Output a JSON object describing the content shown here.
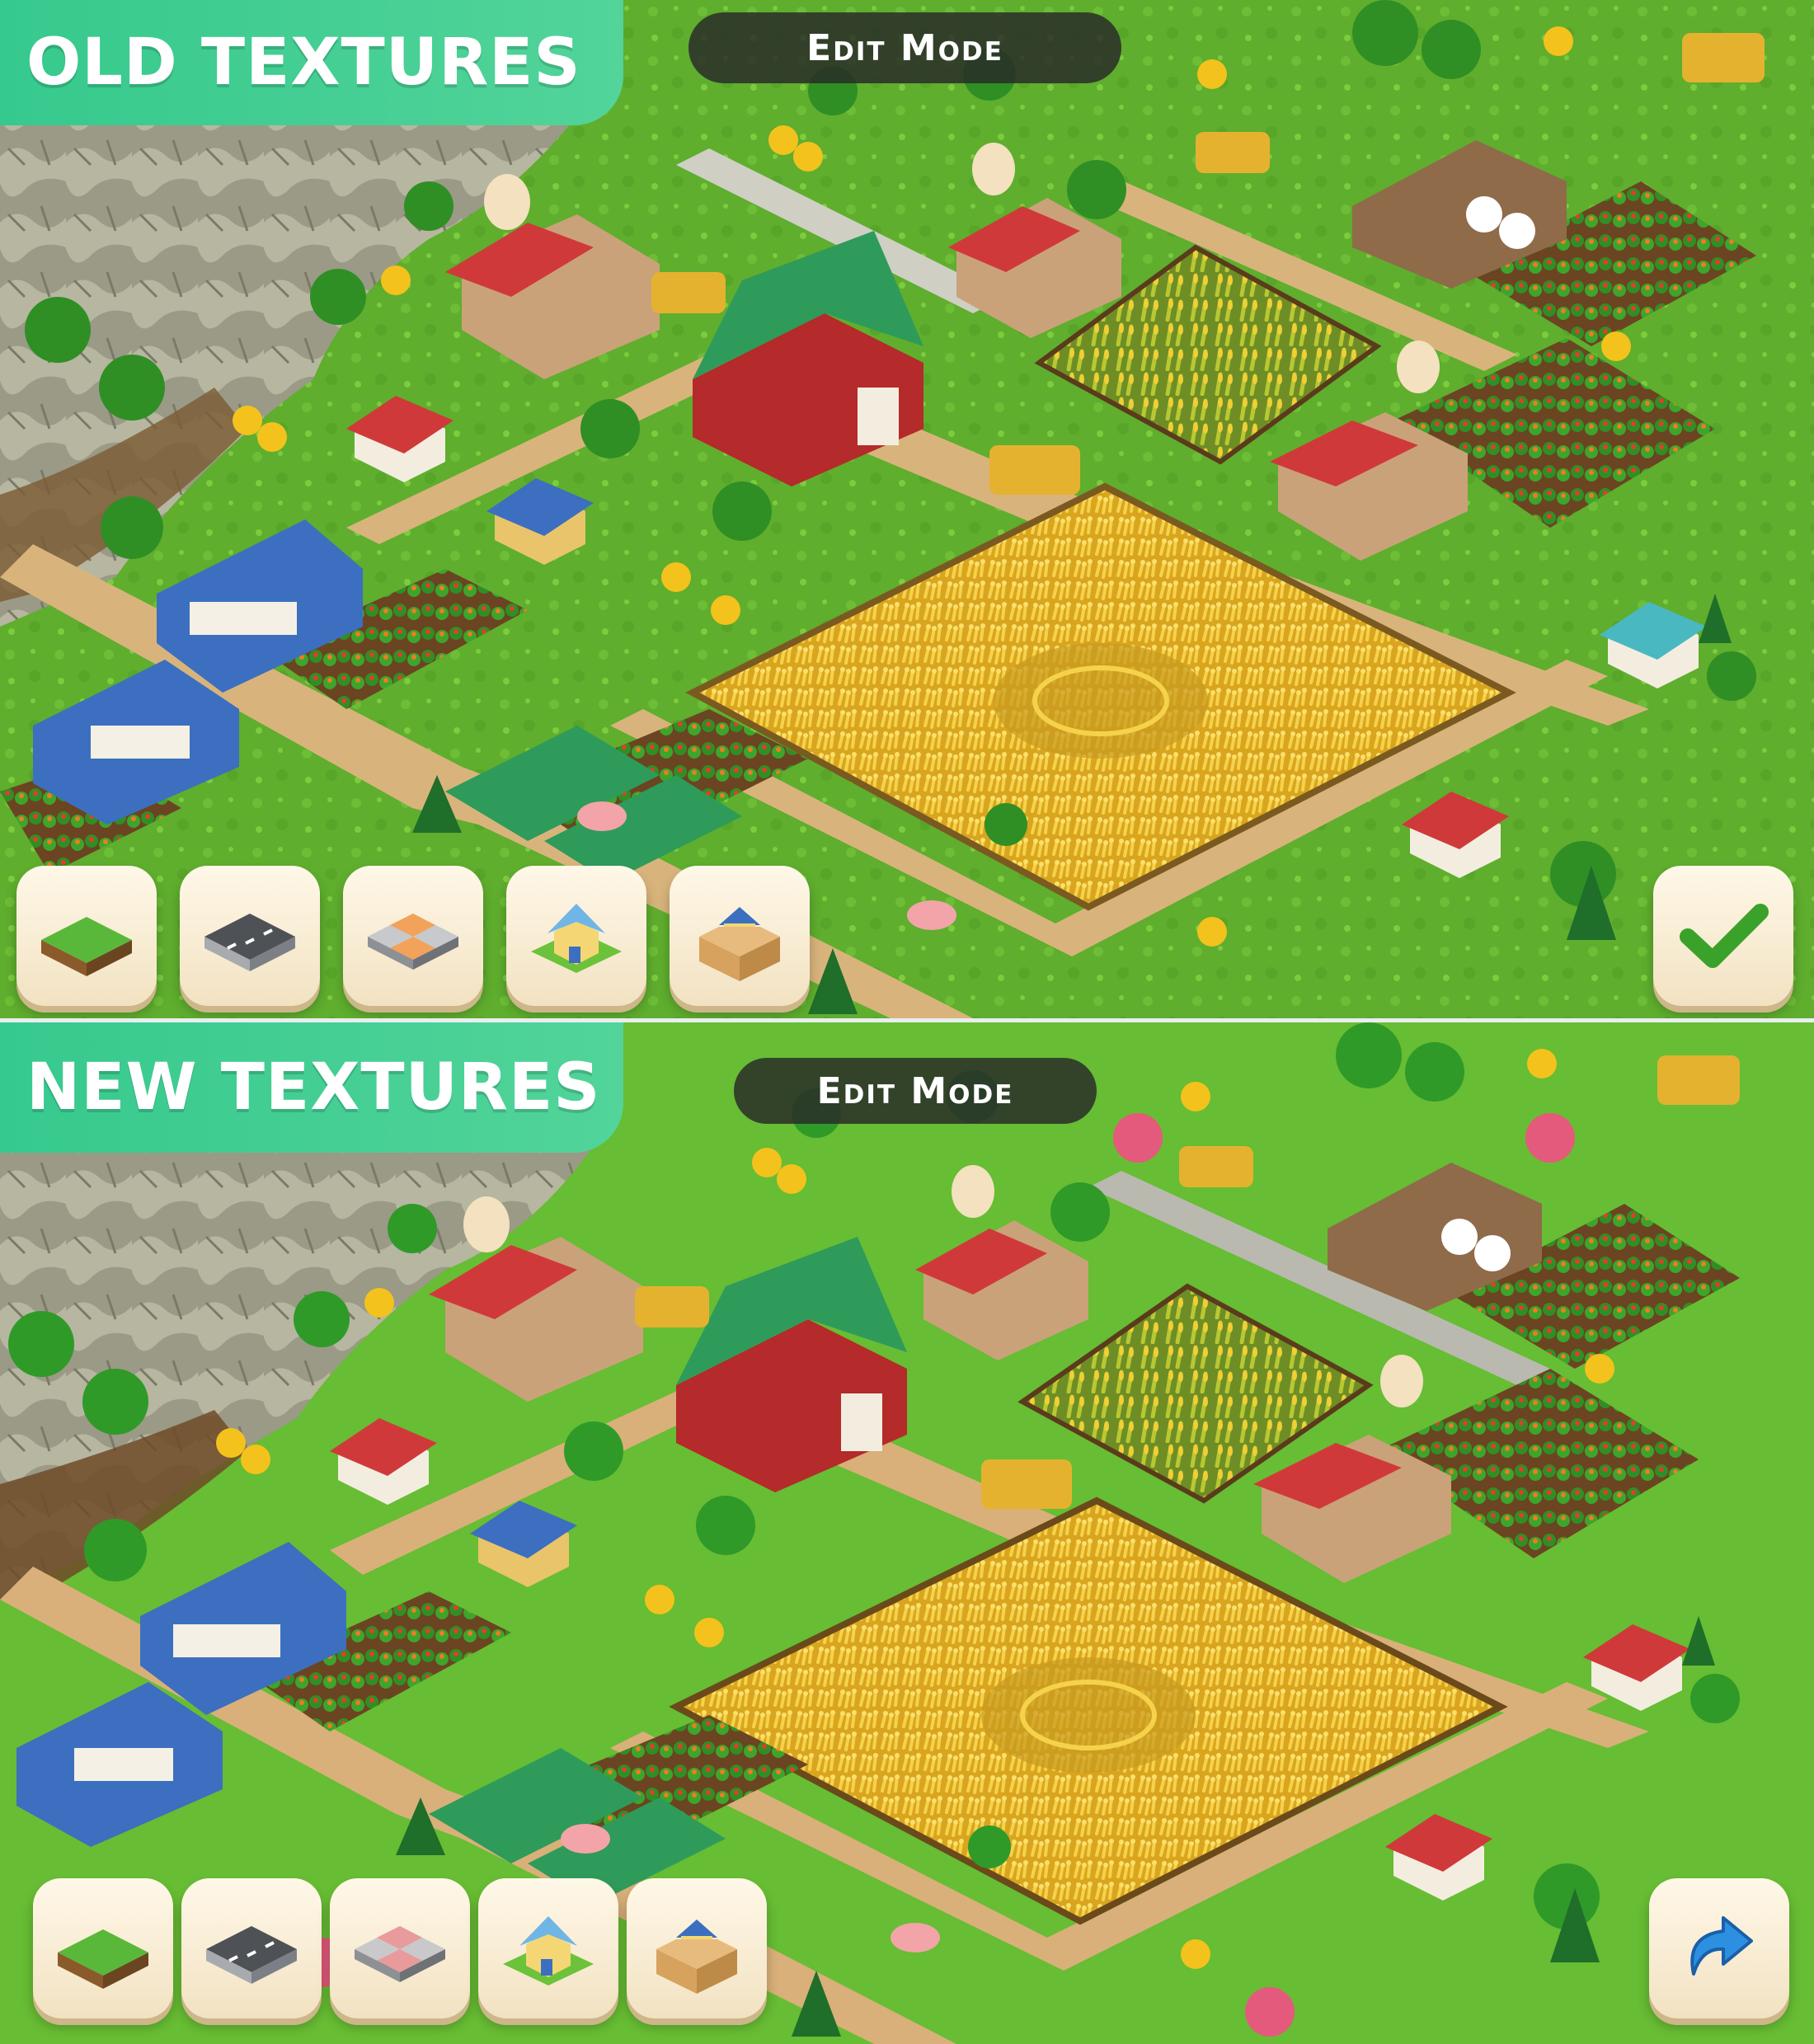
{
  "top_panel": {
    "label": "OLD TEXTURES",
    "mode": "Edit Mode",
    "toolbar": [
      "grass-tile-icon",
      "road-tile-icon",
      "paving-tile-icon",
      "house-on-tile-icon",
      "house-in-box-icon"
    ],
    "confirm_icon": "checkmark-icon"
  },
  "bottom_panel": {
    "label": "NEW TEXTURES",
    "mode": "Edit Mode",
    "toolbar": [
      "grass-tile-icon",
      "road-tile-icon",
      "paving-tile-icon",
      "house-on-tile-icon",
      "house-in-box-icon"
    ],
    "action_icon": "redo-arrow-icon"
  },
  "colors": {
    "banner": "#3ccb90",
    "grass": "#63b52f",
    "wheat": "#e8b626",
    "path": "#d8b47c",
    "pill": "#2b2b2b"
  }
}
